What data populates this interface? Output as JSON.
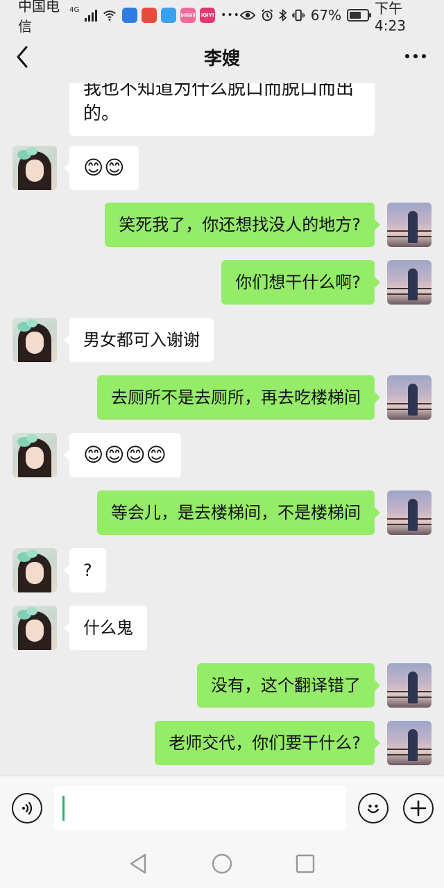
{
  "status_bar": {
    "carrier": "中国电信",
    "network": "4G",
    "battery_percent": "67%",
    "battery_level": 0.67,
    "time": "下午4:23",
    "app_badges": [
      {
        "icon": "app-icon-blue",
        "color": "#2f7de1"
      },
      {
        "icon": "app-icon-red",
        "color": "#e84a3c"
      },
      {
        "icon": "app-icon-browser",
        "color": "#3aa0f0"
      },
      {
        "icon": "app-icon-bilibili",
        "color": "#f06a9b",
        "text": "bilibili"
      },
      {
        "icon": "app-icon-iqiyi",
        "color": "#e2386e",
        "text": "iQIYI"
      }
    ]
  },
  "header": {
    "title": "李嫂"
  },
  "messages": [
    {
      "side": "left",
      "text": "我也不知道为什么脱口而脱口而出的。",
      "cut": true
    },
    {
      "side": "left",
      "text": "😊😊",
      "emoji": true
    },
    {
      "side": "right",
      "text": "笑死我了，你还想找没人的地方?"
    },
    {
      "side": "right",
      "text": "你们想干什么啊?"
    },
    {
      "side": "left",
      "text": "男女都可入谢谢"
    },
    {
      "side": "right",
      "text": "去厕所不是去厕所，再去吃楼梯间"
    },
    {
      "side": "left",
      "text": "😊😊😊😊",
      "emoji": true
    },
    {
      "side": "right",
      "text": "等会儿，是去楼梯间，不是楼梯间"
    },
    {
      "side": "left",
      "text": "?"
    },
    {
      "side": "left",
      "text": "什么鬼"
    },
    {
      "side": "right",
      "text": "没有，这个翻译错了"
    },
    {
      "side": "right",
      "text": "老师交代，你们要干什么?"
    }
  ],
  "input": {
    "value": "",
    "placeholder": ""
  },
  "colors": {
    "background": "#ededed",
    "self_bubble": "#95ec69",
    "other_bubble": "#ffffff",
    "caret": "#2aae67"
  }
}
